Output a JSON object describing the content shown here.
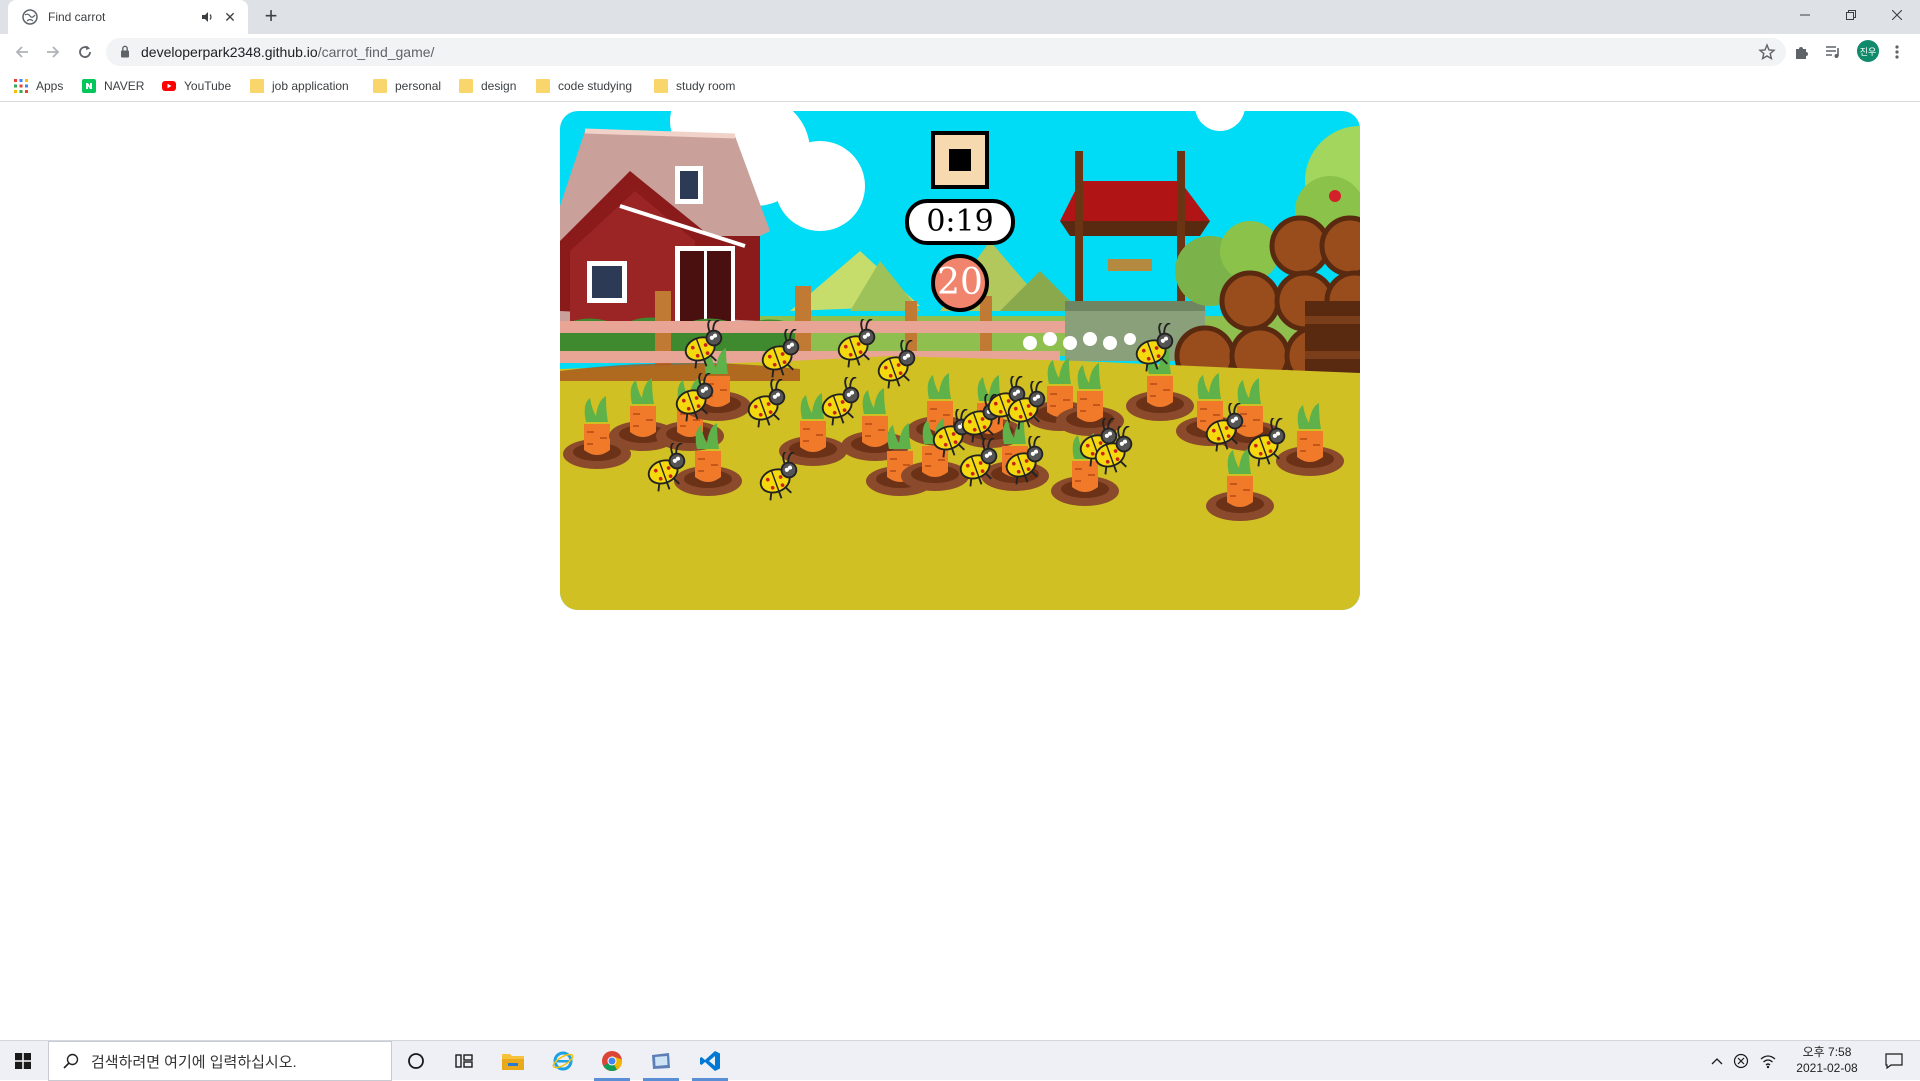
{
  "browser": {
    "tab": {
      "title": "Find carrot"
    },
    "url": {
      "domain": "developerpark2348.github.io",
      "path": "/carrot_find_game/"
    },
    "profile_initials": "진우",
    "bookmarks": [
      {
        "label": "Apps",
        "icon": "apps-grid-icon"
      },
      {
        "label": "NAVER",
        "icon": "naver-icon"
      },
      {
        "label": "YouTube",
        "icon": "youtube-icon"
      },
      {
        "label": "job application",
        "icon": "folder-icon"
      },
      {
        "label": "personal",
        "icon": "folder-icon"
      },
      {
        "label": "design",
        "icon": "folder-icon"
      },
      {
        "label": "code studying",
        "icon": "folder-icon"
      },
      {
        "label": "study room",
        "icon": "folder-icon"
      }
    ]
  },
  "game": {
    "timer": "0:19",
    "score": "20",
    "carrot_count": 20,
    "bug_count": 20
  },
  "taskbar": {
    "search_placeholder": "검색하려면 여기에 입력하십시오.",
    "time": "오후 7:58",
    "date": "2021-02-08"
  }
}
